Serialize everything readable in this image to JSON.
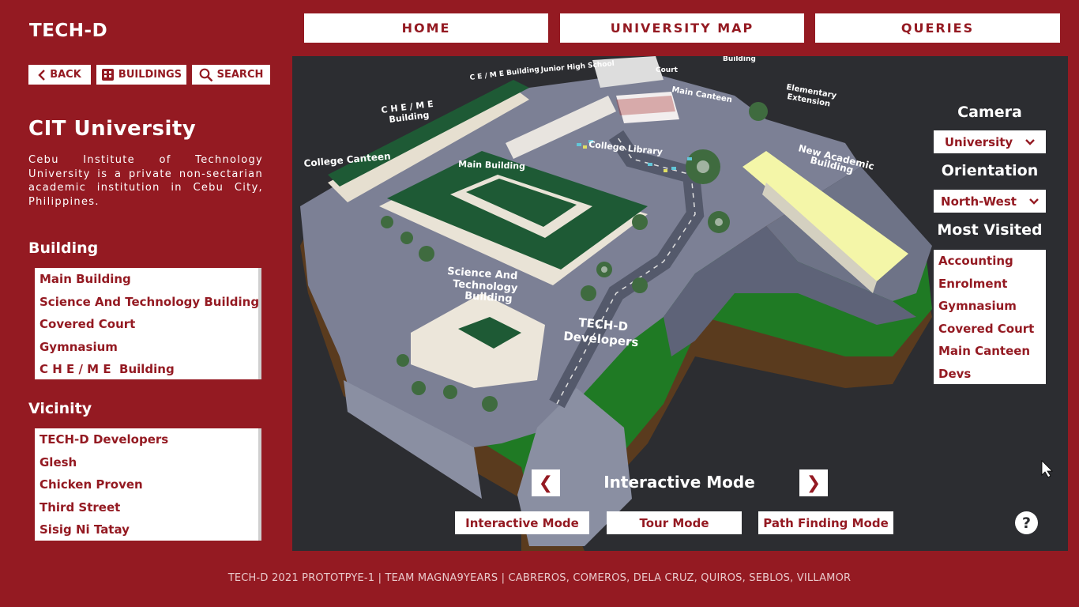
{
  "brand": "TECH-D",
  "nav": {
    "home": "HOME",
    "map": "UNIVERSITY MAP",
    "queries": "QUERIES"
  },
  "toolbar": {
    "back": "BACK",
    "buildings": "BUILDINGS",
    "search": "SEARCH"
  },
  "university": {
    "title": "CIT University",
    "description": "Cebu Institute of Technology University is a private non-sectarian academic institution in Cebu City, Philippines."
  },
  "building_section": {
    "heading": "Building",
    "items": [
      "Main Building",
      "Science And Technology Building",
      "Covered Court",
      "Gymnasium",
      "C H E / M E  Building"
    ]
  },
  "vicinity_section": {
    "heading": "Vicinity",
    "items": [
      "TECH-D Developers",
      "Glesh",
      "Chicken Proven",
      "Third Street",
      "Sisig Ni Tatay"
    ]
  },
  "map_labels": {
    "college_canteen": "College Canteen",
    "cheme_line1": "C H E / M E",
    "cheme_line2": "Building",
    "ceme": "C E / M E  Building",
    "junior_high": "Junior High School",
    "covered_court": "Court",
    "building_top": "Building",
    "main_canteen": "Main Canteen",
    "elementary1": "Elementary",
    "elementary2": "Extension",
    "college_library": "College Library",
    "main_building": "Main Building",
    "new_academic1": "New Academic",
    "new_academic2": "Building",
    "sci_tech1": "Science And",
    "sci_tech2": "Technology",
    "sci_tech3": "Building",
    "techd1": "TECH-D",
    "techd2": "Developers"
  },
  "side_panel": {
    "camera_heading": "Camera",
    "camera_value": "University",
    "orientation_heading": "Orientation",
    "orientation_value": "North-West",
    "most_visited_heading": "Most Visited",
    "most_visited": [
      "Accounting",
      "Enrolment",
      "Gymnasium",
      "Covered Court",
      "Main Canteen",
      "Devs"
    ]
  },
  "mode": {
    "title": "Interactive Mode",
    "prev": "❮",
    "next": "❯",
    "buttons": [
      "Interactive Mode",
      "Tour Mode",
      "Path Finding Mode"
    ],
    "help": "?"
  },
  "footer": "TECH-D 2021 PROTOTPYE-1 | TEAM MAGNA9YEARS | CABREROS, COMEROS, DELA CRUZ, QUIROS, SEBLOS, VILLAMOR",
  "colors": {
    "brand": "#941a22",
    "viewport": "#2c2d31",
    "roof": "#1e5a35",
    "ground": "#6d7387"
  }
}
